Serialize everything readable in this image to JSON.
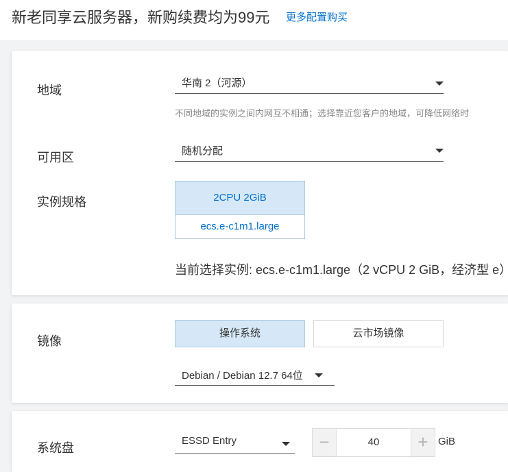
{
  "header": {
    "title": "新老同享云服务器，新购续费均为99元",
    "link": "更多配置购买"
  },
  "region": {
    "label": "地域",
    "value": "华南 2（河源）",
    "hint": "不同地域的实例之间内网互不相通；选择靠近您客户的地域，可降低网络时"
  },
  "zone": {
    "label": "可用区",
    "value": "随机分配"
  },
  "spec": {
    "label": "实例规格",
    "cpu_mem": "2CPU 2GiB",
    "type": "ecs.e-c1m1.large",
    "current": "当前选择实例: ecs.e-c1m1.large（2 vCPU 2 GiB，经济型 e）"
  },
  "image": {
    "label": "镜像",
    "tabs": [
      "操作系统",
      "云市场镜像"
    ],
    "active_tab": 0,
    "os_value": "Debian / Debian 12.7 64位"
  },
  "disk": {
    "label": "系统盘",
    "type": "ESSD Entry",
    "size": "40",
    "unit": "GiB",
    "minus": "−",
    "plus": "+"
  },
  "colors": {
    "accent": "#0070cc",
    "selected_bg": "#d6e8f7",
    "selected_border": "#a9cbe6"
  }
}
